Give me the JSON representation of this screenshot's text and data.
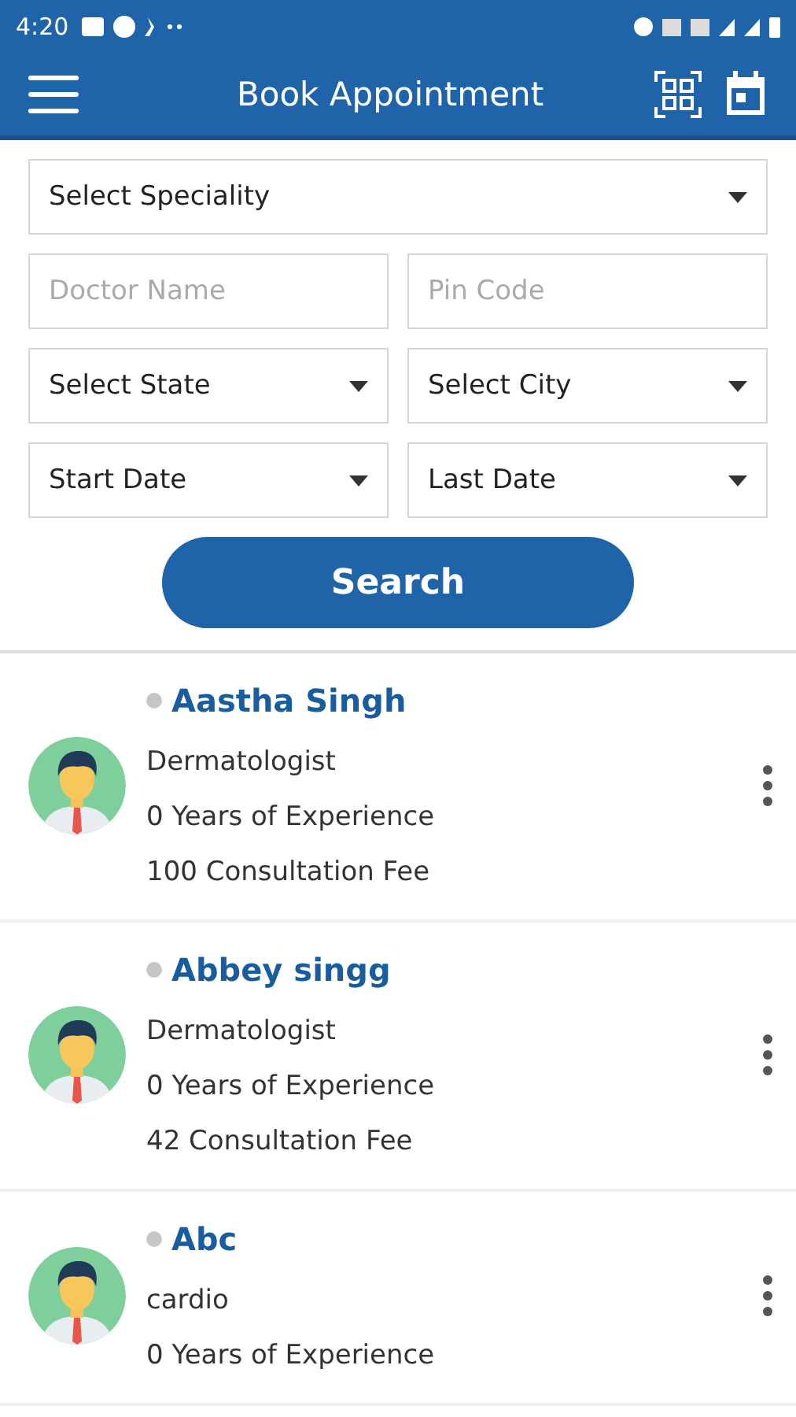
{
  "status_bar": {
    "time": "4:20"
  },
  "toolbar": {
    "title": "Book Appointment"
  },
  "form": {
    "rows": [
      [
        {
          "kind": "select",
          "label": "Select Speciality"
        }
      ],
      [
        {
          "kind": "input",
          "placeholder": "Doctor Name"
        },
        {
          "kind": "input",
          "placeholder": "Pin Code"
        }
      ],
      [
        {
          "kind": "select",
          "label": "Select State"
        },
        {
          "kind": "select",
          "label": "Select City"
        }
      ],
      [
        {
          "kind": "select",
          "label": "Start Date"
        },
        {
          "kind": "select",
          "label": "Last Date"
        }
      ]
    ],
    "button": "Search"
  },
  "doctors": [
    {
      "name": "Aastha Singh",
      "online": false,
      "speciality": "Dermatologist",
      "experience": "0 Years of Experience",
      "fee": "100 Consultation Fee"
    },
    {
      "name": "Abbey singg",
      "online": false,
      "speciality": "Dermatologist",
      "experience": "0 Years of Experience",
      "fee": "42 Consultation Fee"
    },
    {
      "name": "Abc",
      "online": false,
      "speciality": "cardio",
      "experience": "0 Years of Experience"
    }
  ]
}
